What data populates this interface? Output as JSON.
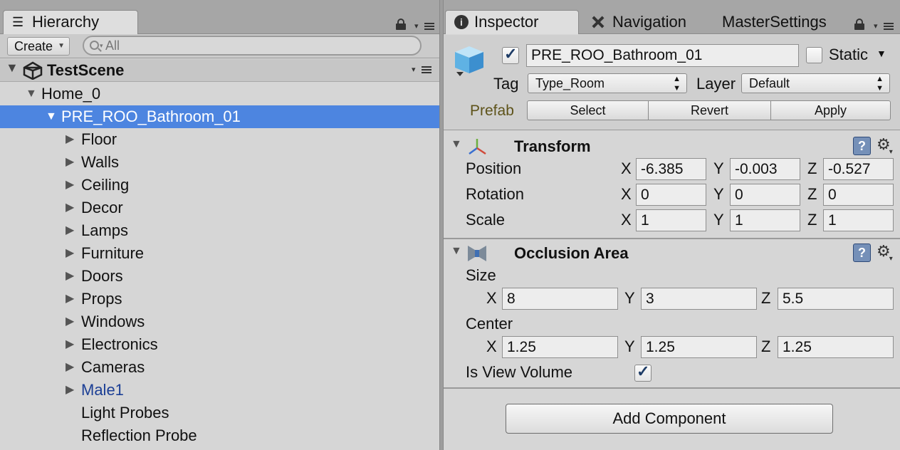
{
  "hierarchy": {
    "tab_label": "Hierarchy",
    "create_label": "Create",
    "search_placeholder": "All",
    "scene_name": "TestScene",
    "items": [
      {
        "label": "Home_0",
        "depth": 1,
        "arrow": "▼"
      },
      {
        "label": "PRE_ROO_Bathroom_01",
        "depth": 2,
        "arrow": "▼",
        "selected": true
      },
      {
        "label": "Floor",
        "depth": 3,
        "arrow": "▶"
      },
      {
        "label": "Walls",
        "depth": 3,
        "arrow": "▶"
      },
      {
        "label": "Ceiling",
        "depth": 3,
        "arrow": "▶"
      },
      {
        "label": "Decor",
        "depth": 3,
        "arrow": "▶"
      },
      {
        "label": "Lamps",
        "depth": 3,
        "arrow": "▶"
      },
      {
        "label": "Furniture",
        "depth": 3,
        "arrow": "▶"
      },
      {
        "label": "Doors",
        "depth": 3,
        "arrow": "▶"
      },
      {
        "label": "Props",
        "depth": 3,
        "arrow": "▶"
      },
      {
        "label": "Windows",
        "depth": 3,
        "arrow": "▶"
      },
      {
        "label": "Electronics",
        "depth": 3,
        "arrow": "▶"
      },
      {
        "label": "Cameras",
        "depth": 3,
        "arrow": "▶"
      },
      {
        "label": "Male1",
        "depth": 3,
        "arrow": "▶",
        "prefab_link": true
      },
      {
        "label": "Light Probes",
        "depth": 3,
        "arrow": ""
      },
      {
        "label": "Reflection Probe",
        "depth": 3,
        "arrow": ""
      }
    ]
  },
  "inspector": {
    "tabs": [
      "Inspector",
      "Navigation",
      "MasterSettings"
    ],
    "object_name": "PRE_ROO_Bathroom_01",
    "active": true,
    "static_label": "Static",
    "static_checked": false,
    "tag_label": "Tag",
    "tag_value": "Type_Room",
    "layer_label": "Layer",
    "layer_value": "Default",
    "prefab_label": "Prefab",
    "prefab_buttons": [
      "Select",
      "Revert",
      "Apply"
    ],
    "transform": {
      "title": "Transform",
      "position_label": "Position",
      "rotation_label": "Rotation",
      "scale_label": "Scale",
      "position": [
        "-6.385",
        "-0.003",
        "-0.527"
      ],
      "rotation": [
        "0",
        "0",
        "0"
      ],
      "scale": [
        "1",
        "1",
        "1"
      ]
    },
    "occlusion": {
      "title": "Occlusion Area",
      "size_label": "Size",
      "center_label": "Center",
      "size": [
        "8",
        "3",
        "5.5"
      ],
      "center": [
        "1.25",
        "1.25",
        "1.25"
      ],
      "view_volume_label": "Is View Volume",
      "view_volume": true
    },
    "axis_labels": [
      "X",
      "Y",
      "Z"
    ],
    "help_glyph": "?",
    "add_component_label": "Add Component"
  },
  "colors": {
    "selection": "#4d85e0",
    "prefab_text": "#1c3f95",
    "prefab_label": "#5e531a",
    "panel_bg": "#d6d6d6"
  },
  "icons": {
    "hierarchy_tab": "list-icon",
    "inspector_tab": "info-icon",
    "navigation_tab": "navigation-icon",
    "scene": "unity-logo-icon",
    "object": "cube-icon",
    "transform": "transform-axes-icon",
    "occlusion": "occlusion-area-icon",
    "help": "help-book-icon",
    "settings": "gear-icon"
  }
}
